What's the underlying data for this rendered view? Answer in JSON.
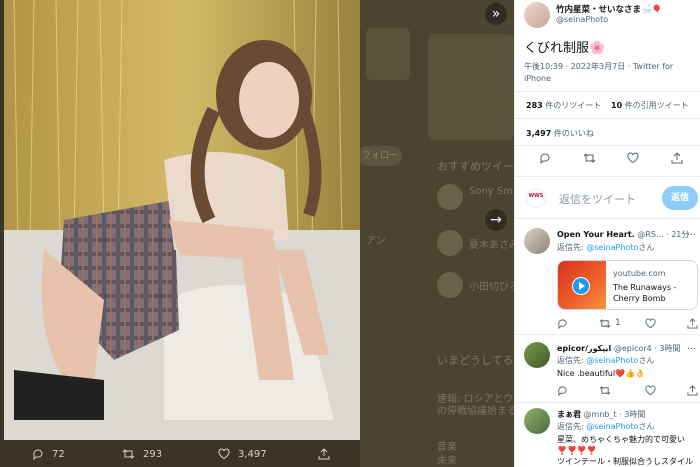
{
  "background": {
    "follow_label": "フォロー",
    "recommend_heading": "おすすめツイー",
    "suggest_1_name": "Sony Smart",
    "suggest_2_name": "夏木あさみ",
    "suggest_3_name": "小田切ひろ",
    "trends_heading": "いまどうしてる",
    "trend_1": "速報: ロシアとウク",
    "trend_2": "の停戦協議始まる",
    "trend_3": "音楽",
    "trend_4": "未来",
    "trend_5": "アン"
  },
  "photo_actions": {
    "reply_count": "72",
    "retweet_count": "293",
    "like_count": "3,497"
  },
  "author": {
    "name": "竹内星菜・せいなさま🛁🎈",
    "handle": "@seinaPhoto"
  },
  "tweet": {
    "text": "くびれ制服🌸",
    "time": "午後10:39 · 2022年3月7日 · ",
    "client": "Twitter for iPhone",
    "retweets": "283",
    "retweets_label": " 件のリツイート",
    "quotes": "10",
    "quotes_label": " 件の引用ツイート",
    "likes": "3,497",
    "likes_label": " 件のいいね"
  },
  "composer": {
    "avatar_text": "WWS",
    "placeholder": "返信をツイート",
    "button": "返信"
  },
  "replies": [
    {
      "name": "Open Your Heart.",
      "handle": "@RS...",
      "time": "· 21分",
      "to_prefix": "返信先: ",
      "to_mention": "@seinaPhoto",
      "to_suffix": "さん",
      "card_domain": "youtube.com",
      "card_title": "The Runaways - Cherry Bomb",
      "retweets": "1",
      "likes": ""
    },
    {
      "name": "epicor/ایپکور",
      "handle": "@epicor4",
      "time": "· 3時間",
      "to_prefix": "返信先: ",
      "to_mention": "@seinaPhoto",
      "to_suffix": "さん",
      "body": "Nice .beautiful❤️👍👌",
      "retweets": "",
      "likes": ""
    },
    {
      "name": "まぁ君",
      "handle": "@mnb_t",
      "time": "· 3時間",
      "to_prefix": "返信先: ",
      "to_mention": "@seinaPhoto",
      "to_suffix": "さん",
      "body_1": "星菜、めちゃくちゃ魅力的で可愛い",
      "body_2": "❣️❣️❣️❣️",
      "body_3": "ツインテール・制服似合うしスタイル"
    }
  ],
  "icons": {
    "more": "…",
    "expand": "»",
    "next": "→"
  }
}
